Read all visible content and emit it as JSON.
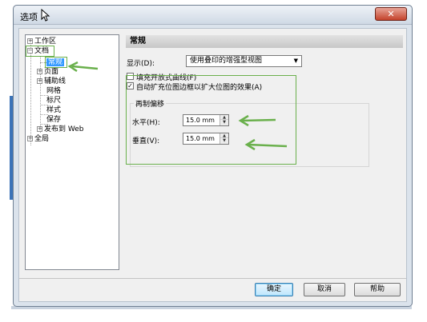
{
  "window": {
    "title": "选项",
    "close_glyph": "✕"
  },
  "tree": {
    "items": [
      {
        "label": "工作区",
        "expander": "+"
      },
      {
        "label": "文档",
        "expander": "−"
      },
      {
        "label": "常规"
      },
      {
        "label": "页面",
        "expander": "+"
      },
      {
        "label": "辅助线",
        "expander": "+"
      },
      {
        "label": "网格"
      },
      {
        "label": "标尺"
      },
      {
        "label": "样式"
      },
      {
        "label": "保存"
      },
      {
        "label": "发布到 Web",
        "expander": "+"
      },
      {
        "label": "全局",
        "expander": "+"
      }
    ]
  },
  "panel": {
    "header": "常规",
    "display_label": "显示(D):",
    "display_value": "使用叠印的增强型视图",
    "fill_open_curves": "填充开放式曲线(F)",
    "auto_expand": "自动扩充位图边框以扩大位图的效果(A)",
    "auto_expand_checked": true,
    "fill_open_checked": false,
    "offset_group": "再制偏移",
    "horizontal_label": "水平(H):",
    "horizontal_value": "15.0 mm",
    "vertical_label": "垂直(V):",
    "vertical_value": "15.0 mm"
  },
  "buttons": {
    "ok": "确定",
    "cancel": "取消",
    "help": "帮助"
  },
  "annotation_color": "#6ab04c",
  "selection_color": "#3399ff"
}
